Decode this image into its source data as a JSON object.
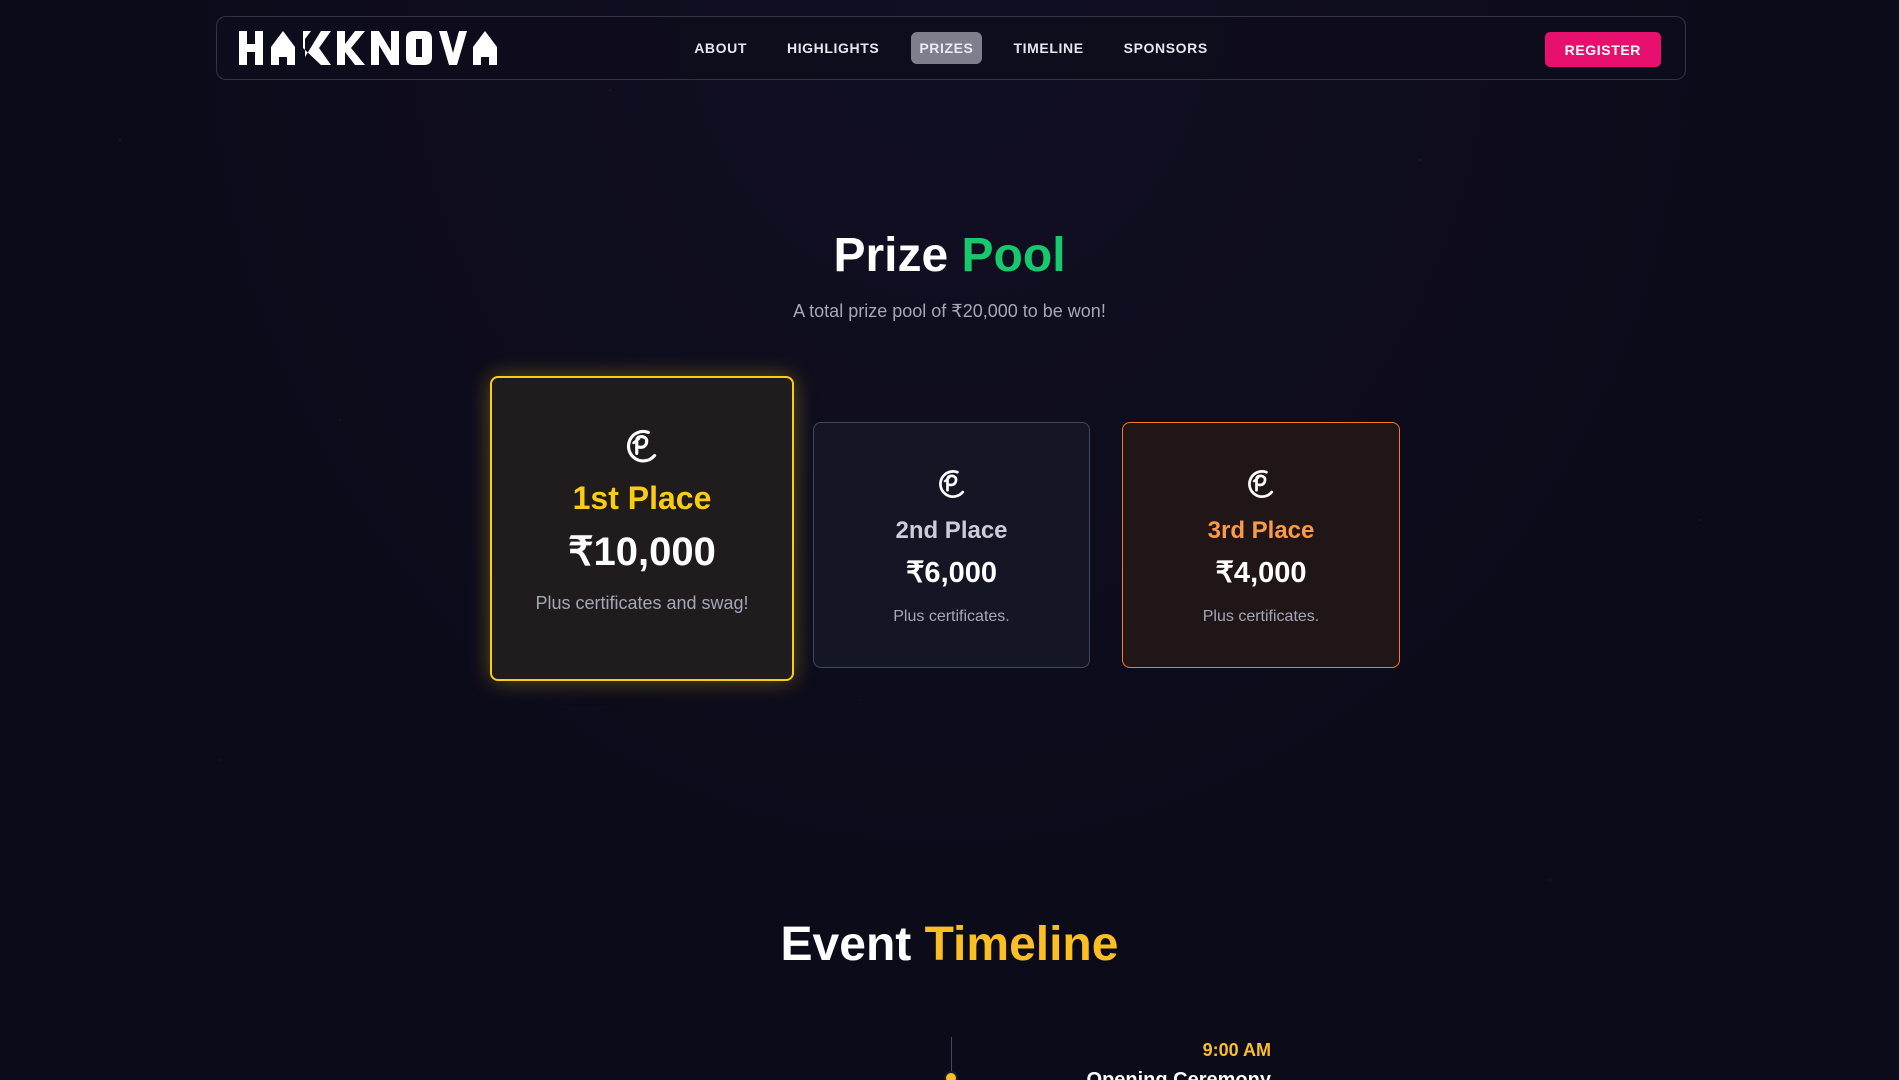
{
  "nav": {
    "logo_text": "HACKNOVA",
    "links": [
      {
        "label": "ABOUT",
        "active": false
      },
      {
        "label": "HIGHLIGHTS",
        "active": false
      },
      {
        "label": "PRIZES",
        "active": true
      },
      {
        "label": "TIMELINE",
        "active": false
      },
      {
        "label": "SPONSORS",
        "active": false
      }
    ],
    "register_label": "REGISTER"
  },
  "prizes": {
    "title_main": "Prize",
    "title_accent": "Pool",
    "subtitle": "A total prize pool of ₹20,000 to be won!",
    "cards": [
      {
        "place": "1st Place",
        "amount": "₹10,000",
        "note": "Plus certificates and swag!",
        "icon": "trophy-icon"
      },
      {
        "place": "2nd Place",
        "amount": "₹6,000",
        "note": "Plus certificates.",
        "icon": "trophy-icon"
      },
      {
        "place": "3rd Place",
        "amount": "₹4,000",
        "note": "Plus certificates.",
        "icon": "trophy-icon"
      }
    ]
  },
  "timeline": {
    "title_main": "Event",
    "title_accent": "Timeline",
    "items": [
      {
        "time": "9:00 AM",
        "event": "Opening Ceremony"
      }
    ]
  },
  "colors": {
    "background": "#0c0b1a",
    "brand_pink": "#e8106f",
    "prize_accent": "#17c96c",
    "timeline_accent": "#fbbf24",
    "gold": "#facc15",
    "silver": "#c9ced9",
    "bronze": "#fb9b4a"
  }
}
